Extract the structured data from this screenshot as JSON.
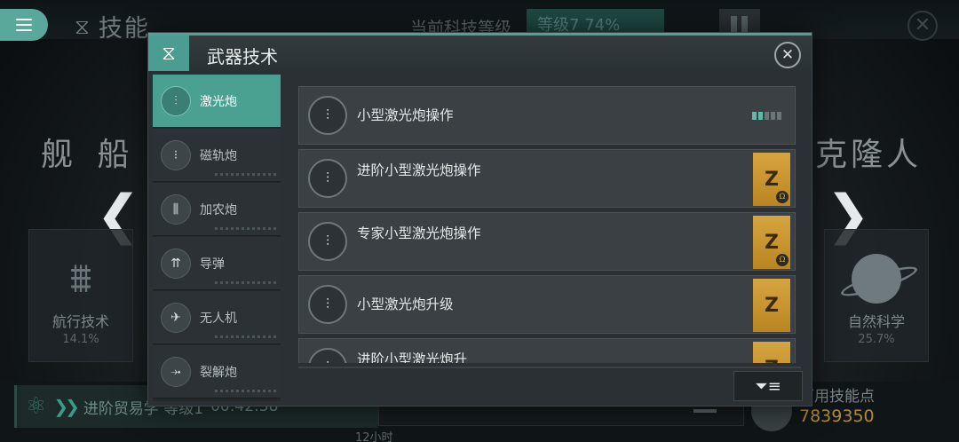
{
  "background": {
    "title": "技能",
    "tech_level_label": "当前科技等级",
    "tech_level_value": "等级7 74%",
    "left_category": "舰 船",
    "right_category": "克隆人",
    "nav_card": {
      "name": "航行技术",
      "percent": "14.1%"
    },
    "science_card": {
      "name": "自然科学",
      "percent": "25.7%"
    },
    "research": {
      "label": "进阶贸易学 等级1",
      "timer": "00:42:38"
    },
    "research_duration": "12小时",
    "skill_points_label": "可用技能点",
    "skill_points_value": "7839350"
  },
  "dialog": {
    "title": "武器技术",
    "sidebar": [
      {
        "label": "激光炮",
        "icon": "laser-cannon-icon",
        "active": true
      },
      {
        "label": "磁轨炮",
        "icon": "railgun-icon",
        "active": false
      },
      {
        "label": "加农炮",
        "icon": "cannon-icon",
        "active": false
      },
      {
        "label": "导弹",
        "icon": "missile-icon",
        "active": false
      },
      {
        "label": "无人机",
        "icon": "drone-icon",
        "active": false
      },
      {
        "label": "裂解炮",
        "icon": "disintegrator-icon",
        "active": false
      }
    ],
    "skills": [
      {
        "name": "小型激光炮操作",
        "level": 2,
        "max_level": 5,
        "locked": false
      },
      {
        "name": "进阶小型激光炮操作",
        "locked": true,
        "omega": true
      },
      {
        "name": "专家小型激光炮操作",
        "locked": true,
        "omega": true
      },
      {
        "name": "小型激光炮升级",
        "locked": true,
        "omega": false
      },
      {
        "name": "进阶小型激光炮升",
        "locked": true,
        "omega": false
      }
    ],
    "lock_glyph": "Z",
    "omega_glyph": "Ω"
  },
  "colors": {
    "accent": "#4aa192",
    "lock": "#c8952f"
  }
}
